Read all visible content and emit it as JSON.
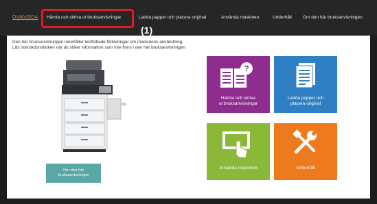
{
  "header": {
    "logo": "OVANSIDA",
    "nav": [
      {
        "label": "Hämta och skriva ut bruksanvisningar",
        "active": true
      },
      {
        "label": "Ladda papper och placera original"
      },
      {
        "label": "Använda maskinen"
      },
      {
        "label": "Underhåll"
      },
      {
        "label": "Om den här bruksanvisningen"
      }
    ],
    "callout": "(1)"
  },
  "intro": {
    "line1": "Den här bruksanvisningen innehåller kortfattade förklaringar om maskinens användning.",
    "line2": "Läs instruktionsboken när du söker information som inte finns i den här bruksanvisningen."
  },
  "about_button": {
    "line1": "Om den här",
    "line2": "bruksanvisningen"
  },
  "tiles": [
    {
      "line1": "Hämta och skriva",
      "line2": "ut bruksanvisningar",
      "color": "#8e2d8f",
      "icon": "manual-question-icon"
    },
    {
      "line1": "Ladda papper och",
      "line2": "placera original",
      "color": "#2f7fc4",
      "icon": "document-stack-icon"
    },
    {
      "line1": "Använda maskinen",
      "line2": "",
      "color": "#8ab839",
      "icon": "touch-screen-icon"
    },
    {
      "line1": "Underhåll",
      "line2": "",
      "color": "#ee7a1e",
      "icon": "tools-icon"
    }
  ]
}
